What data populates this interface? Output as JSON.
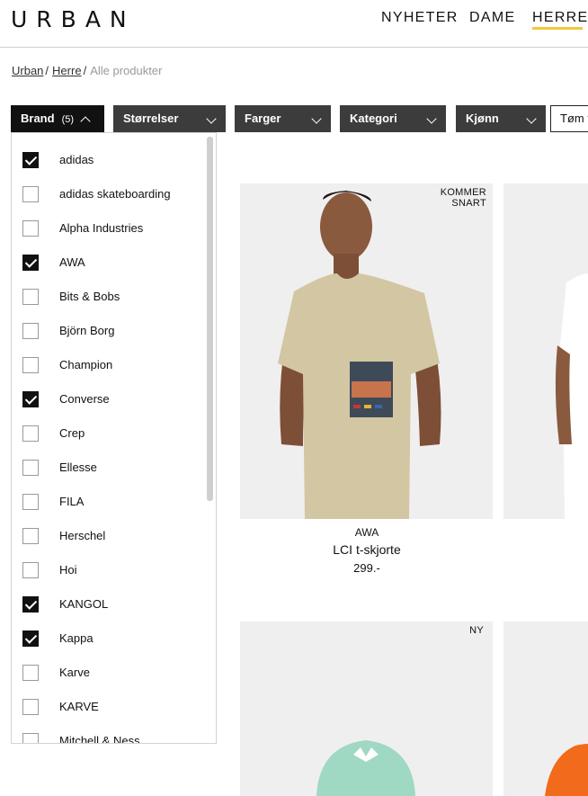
{
  "header": {
    "logo": "URBAN",
    "nav": [
      {
        "label": "NYHETER"
      },
      {
        "label": "DAME"
      },
      {
        "label": "HERRE",
        "active": true
      }
    ],
    "accent_color": "#f0c93a"
  },
  "breadcrumb": {
    "items": [
      "Urban",
      "Herre"
    ],
    "current": "Alle produkter"
  },
  "filters": {
    "brand": {
      "label": "Brand",
      "count": "(5)"
    },
    "sizes": {
      "label": "Størrelser"
    },
    "colors": {
      "label": "Farger"
    },
    "category": {
      "label": "Kategori"
    },
    "gender": {
      "label": "Kjønn"
    },
    "clear_label": "Tøm filter"
  },
  "brand_list": [
    {
      "label": "adidas",
      "checked": true
    },
    {
      "label": "adidas skateboarding",
      "checked": false
    },
    {
      "label": "Alpha Industries",
      "checked": false
    },
    {
      "label": "AWA",
      "checked": true
    },
    {
      "label": "Bits & Bobs",
      "checked": false
    },
    {
      "label": "Björn Borg",
      "checked": false
    },
    {
      "label": "Champion",
      "checked": false
    },
    {
      "label": "Converse",
      "checked": true
    },
    {
      "label": "Crep",
      "checked": false
    },
    {
      "label": "Ellesse",
      "checked": false
    },
    {
      "label": "FILA",
      "checked": false
    },
    {
      "label": "Herschel",
      "checked": false
    },
    {
      "label": "Hoi",
      "checked": false
    },
    {
      "label": "KANGOL",
      "checked": true
    },
    {
      "label": "Kappa",
      "checked": true
    },
    {
      "label": "Karve",
      "checked": false
    },
    {
      "label": "KARVE",
      "checked": false
    },
    {
      "label": "Mitchell & Ness",
      "checked": false
    }
  ],
  "products": [
    {
      "badge_line1": "KOMMER",
      "badge_line2": "SNART",
      "brand": "AWA",
      "name": "LCI t-skjorte",
      "price": "299.-"
    },
    {
      "badge_line1": "NY",
      "badge_line2": ""
    }
  ]
}
